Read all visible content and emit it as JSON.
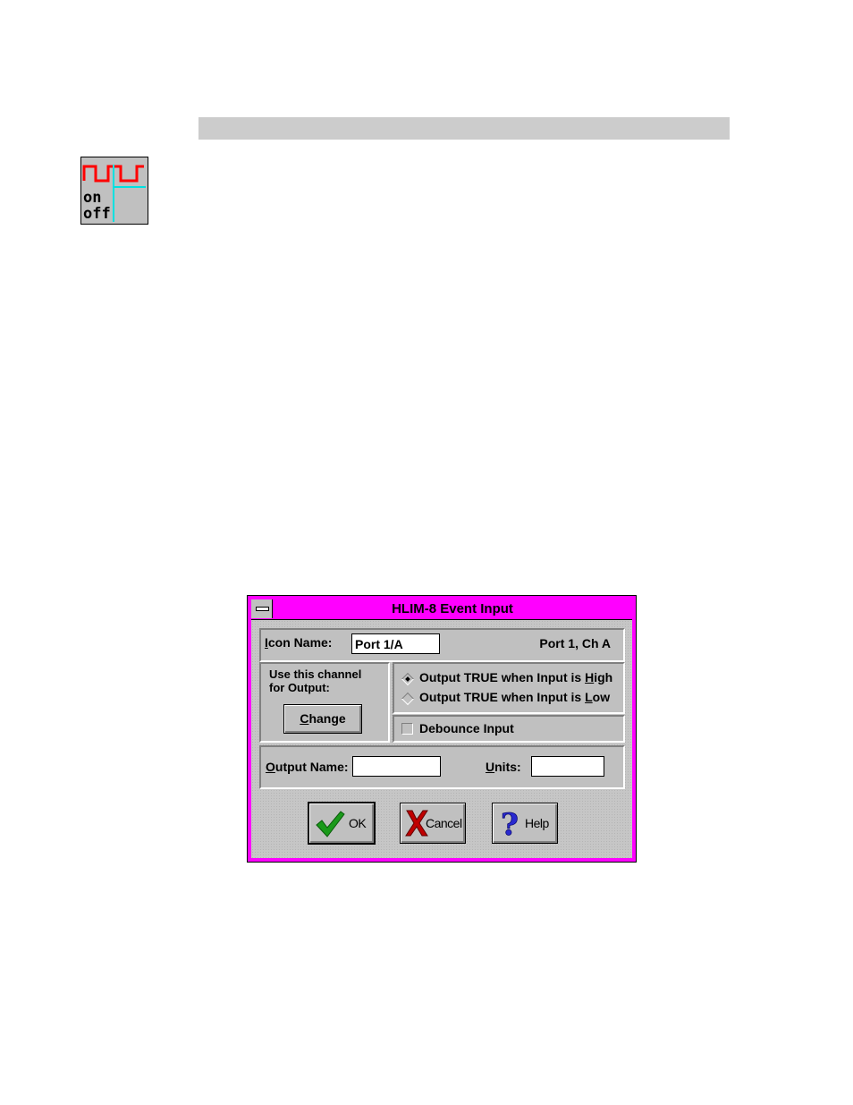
{
  "dialog": {
    "title": "HLIM-8 Event Input",
    "icon_name": {
      "label_underlined": "I",
      "label_rest": "con Name:",
      "value": "Port 1/A"
    },
    "port_info": "Port 1, Ch A",
    "channel_group": {
      "line1": "Use this channel",
      "line2": "for Output:",
      "change_underlined": "C",
      "change_rest": "hange"
    },
    "output_mode": {
      "high_prefix": "Output TRUE when Input is ",
      "high_underlined": "H",
      "high_rest": "igh",
      "low_prefix": "Output TRUE when Input is ",
      "low_underlined": "L",
      "low_rest": "ow",
      "selected": "high"
    },
    "debounce": {
      "label": "Debounce Input",
      "checked": false
    },
    "output_name": {
      "label_underlined": "O",
      "label_rest": "utput Name:",
      "value": ""
    },
    "units": {
      "label_underlined": "U",
      "label_rest": "nits:",
      "value": ""
    },
    "buttons": {
      "ok": "OK",
      "cancel": "Cancel",
      "help": "Help"
    }
  },
  "colors": {
    "title_bar": "#ff00ff",
    "dialog_face": "#c0c0c0",
    "check_green": "#1a9a1a",
    "cancel_red": "#c00000",
    "help_blue": "#2a2ad0",
    "icon_wave_red": "#ff0000",
    "icon_line_cyan": "#00e0e0"
  },
  "icon_texts": {
    "on": "on",
    "off": "off"
  }
}
